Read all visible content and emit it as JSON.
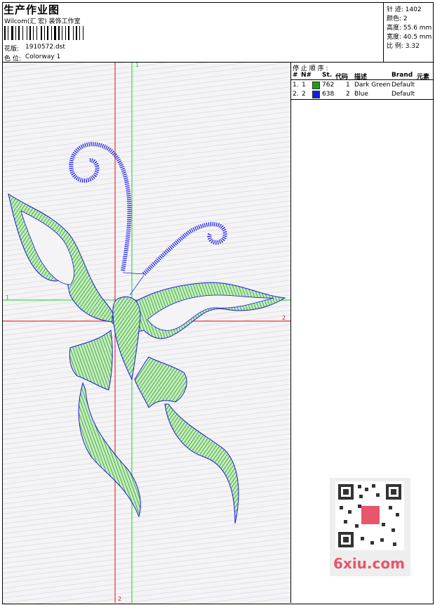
{
  "header": {
    "title": "生产作业图",
    "studio": "Wilcom(汇 宏) 装饰工作室",
    "design_label": "花版:",
    "design_value": "1910572.dst",
    "colorway_label": "色 位:",
    "colorway_value": "Colorway 1"
  },
  "stats": {
    "stitches": "针 迹:  1402",
    "colors": "颜色:  2",
    "height": "高度:  55.6 mm",
    "width": "宽度:  40.5 mm",
    "ratio": "比 例:  3.32"
  },
  "stop_sequence": {
    "title": "停 止 顺 序 :",
    "headers": [
      "#",
      "N#",
      "St.",
      "代码",
      "描述",
      "Brand",
      "元素"
    ],
    "rows": [
      {
        "num": "1.",
        "n": "1",
        "color": "#1e9e1e",
        "stitches": "762",
        "code": "1",
        "desc": "Dark Green",
        "brand": "Default"
      },
      {
        "num": "2.",
        "n": "2",
        "color": "#1a1ae6",
        "stitches": "638",
        "code": "2",
        "desc": "Blue",
        "brand": "Default"
      }
    ]
  },
  "axes": {
    "green_v_top": "1",
    "green_h_left": "1",
    "red_h_right": "2",
    "red_v_bottom": "2"
  },
  "colors": {
    "green": "#1e9e1e",
    "blue": "#1a1ae6",
    "red": "#e01010",
    "axis_green": "#22cc22"
  },
  "watermark": {
    "logo": "6xiu.com"
  }
}
